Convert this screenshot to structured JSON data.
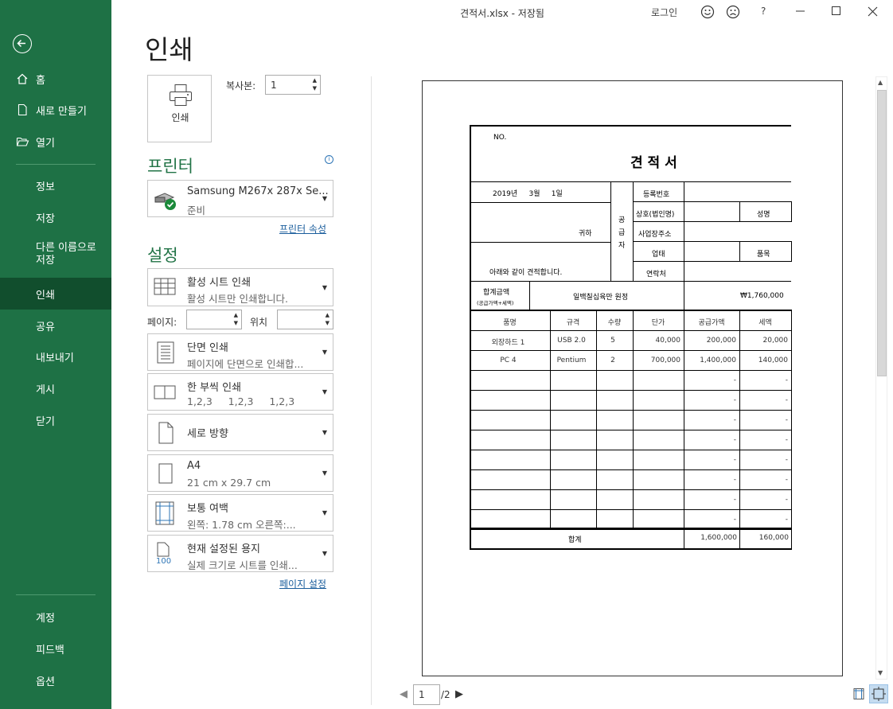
{
  "window": {
    "doc_title": "견적서.xlsx  -  저장됨",
    "login": "로그인",
    "help": "?"
  },
  "sidebar": {
    "items": [
      {
        "label": "홈"
      },
      {
        "label": "새로 만들기"
      },
      {
        "label": "열기"
      },
      {
        "label": "정보"
      },
      {
        "label": "저장"
      },
      {
        "label": "다른 이름으로\n저장"
      },
      {
        "label": "인쇄"
      },
      {
        "label": "공유"
      },
      {
        "label": "내보내기"
      },
      {
        "label": "게시"
      },
      {
        "label": "닫기"
      },
      {
        "label": "계정"
      },
      {
        "label": "피드백"
      },
      {
        "label": "옵션"
      }
    ],
    "line1": "다른 이름으로",
    "line2": "저장"
  },
  "print": {
    "heading": "인쇄",
    "button_label": "인쇄",
    "copies_label": "복사본:",
    "copies_value": "1"
  },
  "printer": {
    "title": "프린터",
    "name": "Samsung M267x 287x Se...",
    "status": "준비",
    "properties_link": "프린터 속성"
  },
  "settings": {
    "title": "설정",
    "sheet": {
      "t1": "활성 시트 인쇄",
      "t2": "활성 시트만 인쇄합니다."
    },
    "pages_label": "페이지:",
    "to_label": "위치",
    "sides": {
      "t1": "단면 인쇄",
      "t2": "페이지에 단면으로 인쇄합..."
    },
    "collate": {
      "t1": "한 부씩 인쇄",
      "t2": "1,2,3     1,2,3     1,2,3"
    },
    "orientation": {
      "t1": "세로 방향"
    },
    "paper": {
      "t1": "A4",
      "t2": "21 cm x 29.7 cm"
    },
    "margins": {
      "t1": "보통 여백",
      "t2": "왼쪽:  1.78 cm     오른쪽:..."
    },
    "scaling": {
      "t1": "현재 설정된 용지",
      "t2": "실제 크기로 시트를 인쇄...",
      "icon_text": "100"
    },
    "page_setup_link": "페이지 설정"
  },
  "preview": {
    "page_current": "1",
    "page_total": "/2",
    "quote": {
      "no": "NO.",
      "title": "견 적 서",
      "date": "2019년     3월     1일",
      "recipient": "귀하",
      "message": "아래와 같이 견적합니다.",
      "supplier_vertical": [
        "공",
        "급",
        "자"
      ],
      "reg_no": "등록번호",
      "company": "상호(법인명)",
      "name": "성명",
      "address": "사업장주소",
      "business": "업태",
      "item_type": "품목",
      "contact": "연락처",
      "total_label": "합계금액",
      "total_sub": "(공급가액+세액)",
      "total_korean": "일백칠십육만 원정",
      "total_amount": "₩1,760,000",
      "columns": [
        "품명",
        "규격",
        "수량",
        "단가",
        "공급가액",
        "세액"
      ],
      "rows": [
        [
          "외장하드 1",
          "USB 2.0",
          "5",
          "40,000",
          "200,000",
          "20,000"
        ],
        [
          "PC 4",
          "Pentium",
          "2",
          "700,000",
          "1,400,000",
          "140,000"
        ],
        [
          "",
          "",
          "",
          "",
          "-",
          "-"
        ],
        [
          "",
          "",
          "",
          "",
          "-",
          "-"
        ],
        [
          "",
          "",
          "",
          "",
          "-",
          "-"
        ],
        [
          "",
          "",
          "",
          "",
          "-",
          "-"
        ],
        [
          "",
          "",
          "",
          "",
          "-",
          "-"
        ],
        [
          "",
          "",
          "",
          "",
          "-",
          "-"
        ],
        [
          "",
          "",
          "",
          "",
          "-",
          "-"
        ],
        [
          "",
          "",
          "",
          "",
          "-",
          "-"
        ]
      ],
      "sum_label": "합계",
      "sum_supply": "1,600,000",
      "sum_tax": "160,000"
    }
  }
}
